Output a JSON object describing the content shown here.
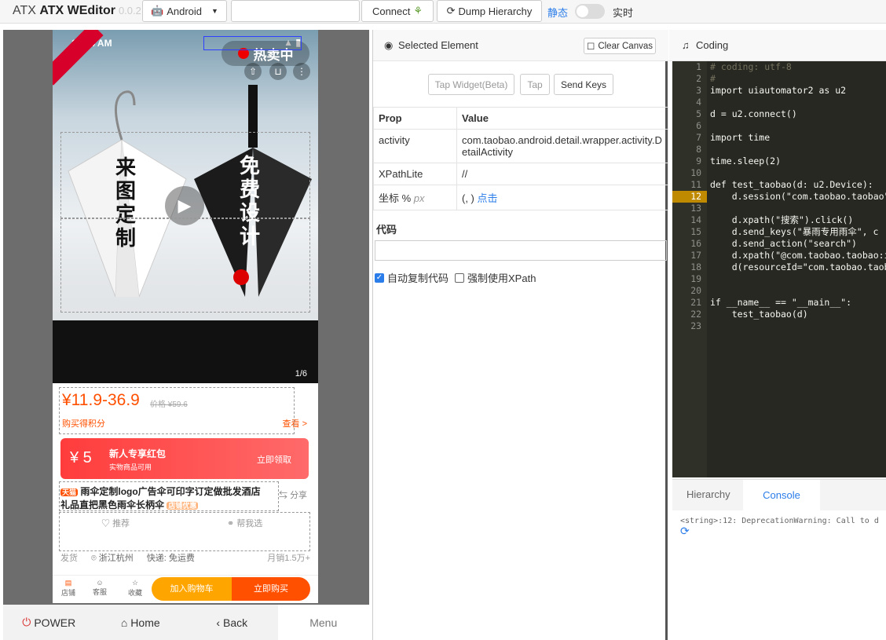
{
  "header": {
    "brand_name": "ATX WEditor",
    "brand_version": "0.0.2",
    "platform_select": "Android",
    "connect_label": "Connect",
    "dump_label": "Dump Hierarchy",
    "static_label": "静态",
    "realtime_label": "实时"
  },
  "phone": {
    "time": "11:34 AM",
    "hot_sale": "热卖中",
    "slogan_left": "来图定制",
    "slogan_right": "免费设计",
    "page_indicator": "1/6",
    "price": "¥11.9-36.9",
    "orig_price": "价格 ¥59.6",
    "points": "购买得积分",
    "view_more": "查看 >",
    "coupon_amount": "¥ 5",
    "coupon_title": "新人专享红包",
    "coupon_sub": "实物商品可用",
    "coupon_action": "立即领取",
    "title_line1": "雨伞定制logo广告伞可印字订定做批发酒店",
    "title_line2": "礼品直把黑色雨伞长柄伞",
    "title_tag": "天猫",
    "title_badge": "店铺优惠",
    "share": "分享",
    "recommend": "推荐",
    "help_choose": "帮我选",
    "ship_from": "发货",
    "location": "浙江杭州",
    "shipping": "快递: 免运费",
    "monthly_sales": "月销1.5万+",
    "store": "店铺",
    "service": "客服",
    "favorite": "收藏",
    "add_cart": "加入购物车",
    "buy_now": "立即购买"
  },
  "phone_nav": {
    "power": "POWER",
    "home": "Home",
    "back": "Back",
    "menu": "Menu"
  },
  "inspector": {
    "title": "Selected Element",
    "clear_canvas": "Clear Canvas",
    "tap_widget": "Tap Widget(Beta)",
    "tap": "Tap",
    "send_keys": "Send Keys",
    "col_prop": "Prop",
    "col_value": "Value",
    "rows": [
      {
        "prop": "activity",
        "value": "com.taobao.android.detail.wrapper.activity.DetailActivity"
      },
      {
        "prop": "XPathLite",
        "value": "//"
      },
      {
        "prop": "坐标 %",
        "prop_unit": "px",
        "value": "(, )",
        "link": "点击"
      }
    ],
    "code_label": "代码",
    "auto_copy": "自动复制代码",
    "force_xpath": "强制使用XPath"
  },
  "coding": {
    "title": "Coding",
    "lines": [
      "# coding: utf-8",
      "#",
      "import uiautomator2 as u2",
      "",
      "d = u2.connect()",
      "",
      "import time",
      "",
      "time.sleep(2)",
      "",
      "def test_taobao(d: u2.Device):",
      "    d.session(\"com.taobao.taobao\"",
      "    ",
      "    d.xpath(\"搜索\").click()",
      "    d.send_keys(\"暴雨专用雨伞\", c",
      "    d.send_action(\"search\")",
      "    d.xpath(\"@com.taobao.taobao:i",
      "    d(resourceId=\"com.taobao.taob",
      "",
      "",
      "if __name__ == \"__main__\":",
      "    test_taobao(d)",
      ""
    ],
    "highlight_line": "12",
    "tab_hierarchy": "Hierarchy",
    "tab_console": "Console",
    "console_text": "<string>:12: DeprecationWarning: Call to d"
  },
  "colors": {
    "accent": "#2b7de9",
    "price": "#ff5000",
    "code_bg": "#272822"
  }
}
